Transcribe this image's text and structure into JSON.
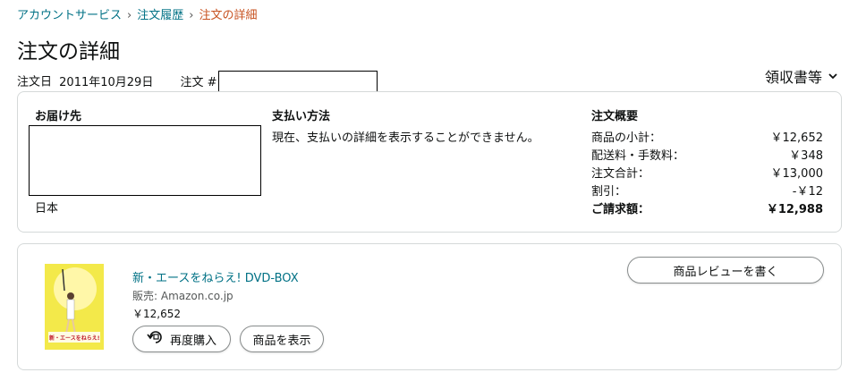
{
  "breadcrumb": {
    "items": [
      "アカウントサービス",
      "注文履歴"
    ],
    "current": "注文の詳細",
    "separator": "›"
  },
  "page": {
    "title": "注文の詳細"
  },
  "order_meta": {
    "date_label": "注文日",
    "date": "2011年10月29日",
    "number_label": "注文 #"
  },
  "receipt": {
    "label": "領収書等"
  },
  "shipping": {
    "heading": "お届け先",
    "country": "日本"
  },
  "payment": {
    "heading": "支払い方法",
    "message": "現在、支払いの詳細を表示することができません。"
  },
  "summary": {
    "heading": "注文概要",
    "rows": [
      {
        "label": "商品の小計：",
        "value": "￥12,652"
      },
      {
        "label": "配送料・手数料：",
        "value": "￥348"
      },
      {
        "label": "注文合計：",
        "value": "￥13,000"
      },
      {
        "label": "割引：",
        "value": "-￥12"
      }
    ],
    "total_label": "ご請求額：",
    "total_value": "￥12,988"
  },
  "item": {
    "title": "新・エースをねらえ! DVD-BOX",
    "seller": "販売: Amazon.co.jp",
    "price": "￥12,652",
    "cover_text": "新・エースをねらえ!",
    "buy_again_label": "再度購入",
    "view_item_label": "商品を表示",
    "review_label": "商品レビューを書く"
  },
  "colors": {
    "link": "#007185",
    "breadcrumb_current": "#c7511f",
    "card_border": "#d5d9d9",
    "button_border": "#888c8c",
    "cover_yellow": "#f3e94a"
  },
  "icons": {
    "receipt_chevron": "chevron-down-icon",
    "buy_again": "buy-again-icon"
  }
}
